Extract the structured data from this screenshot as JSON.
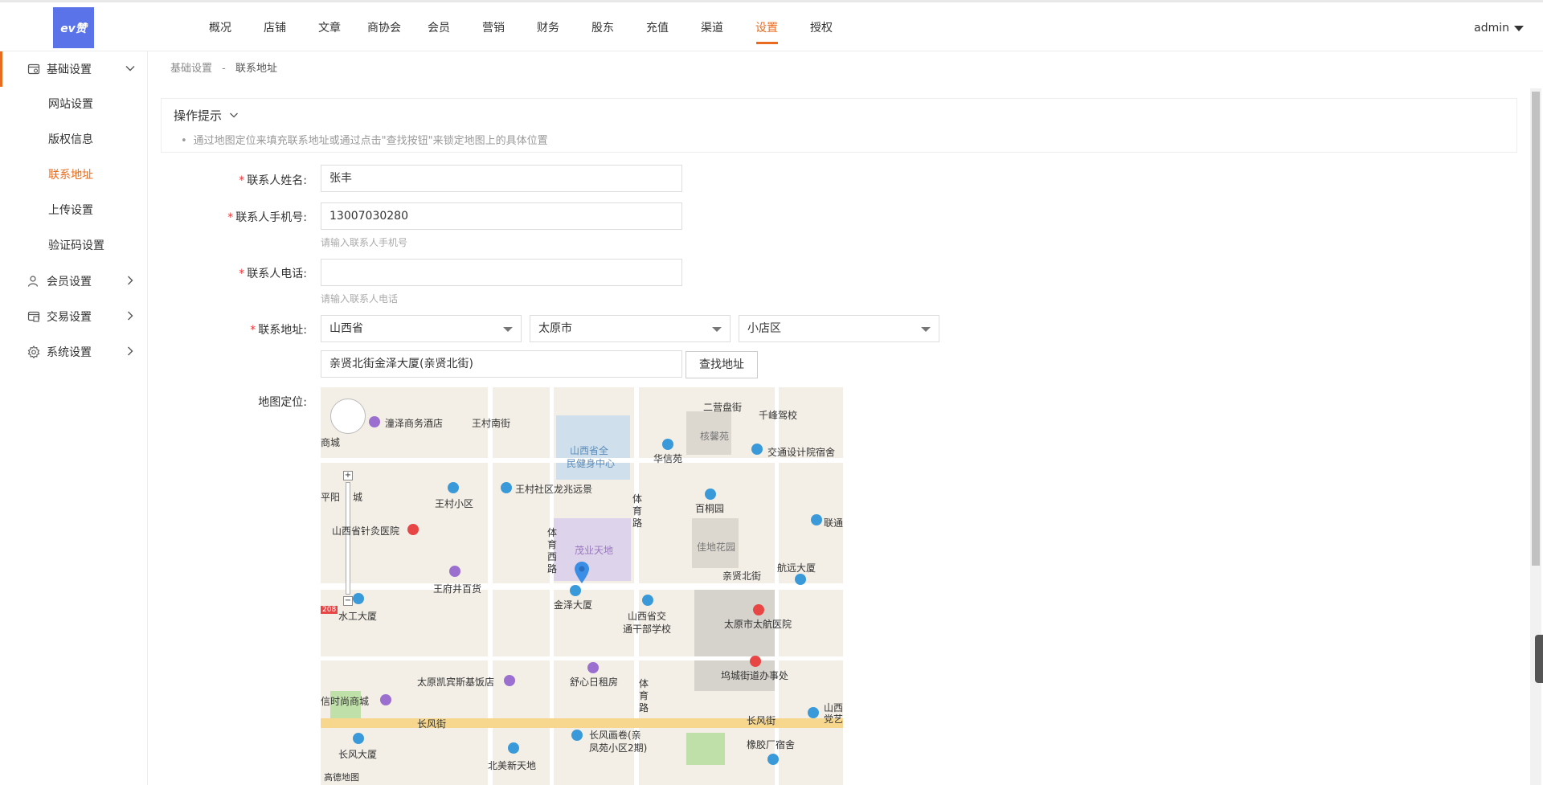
{
  "header": {
    "logo_text": "ev赞",
    "nav": [
      "概况",
      "店铺",
      "文章",
      "商协会",
      "会员",
      "营销",
      "财务",
      "股东",
      "充值",
      "渠道",
      "设置",
      "授权"
    ],
    "active_nav": "设置",
    "user": "admin"
  },
  "sidebar": {
    "groups": [
      {
        "label": "基础设置",
        "icon": "settings-card-icon",
        "open": true,
        "items": [
          "网站设置",
          "版权信息",
          "联系地址",
          "上传设置",
          "验证码设置"
        ]
      },
      {
        "label": "会员设置",
        "icon": "user-icon",
        "open": false
      },
      {
        "label": "交易设置",
        "icon": "trade-icon",
        "open": false
      },
      {
        "label": "系统设置",
        "icon": "gear-icon",
        "open": false
      }
    ],
    "active_item": "联系地址"
  },
  "breadcrumb": {
    "parent": "基础设置",
    "separator": "-",
    "current": "联系地址"
  },
  "tips": {
    "title": "操作提示",
    "text": "通过地图定位来填充联系地址或通过点击\"查找按钮\"来锁定地图上的具体位置"
  },
  "form": {
    "name_label": "联系人姓名:",
    "name_value": "张丰",
    "mobile_label": "联系人手机号:",
    "mobile_value": "13007030280",
    "mobile_hint": "请输入联系人手机号",
    "phone_label": "联系人电话:",
    "phone_value": "",
    "phone_hint": "请输入联系人电话",
    "address_label": "联系地址:",
    "province": "山西省",
    "city": "太原市",
    "district": "小店区",
    "street_value": "亲贤北街金泽大厦(亲贤北街)",
    "find_button": "查找地址",
    "map_label": "地图定位:"
  },
  "map": {
    "labels": [
      "潼泽商务酒店",
      "王村南街",
      "山西省全",
      "民健身中心",
      "二营盘街",
      "千峰驾校",
      "核馨苑",
      "华信苑",
      "交通设计院宿舍",
      "王村小区",
      "王村社区龙兆远景",
      "体",
      "育",
      "路",
      "百桐园",
      "联通",
      "平阳",
      "城",
      "山西省针灸医院",
      "体",
      "育",
      "西",
      "路",
      "茂业天地",
      "佳地花园",
      "亲贤北街",
      "航远大厦",
      "王府井百货",
      "金泽大厦",
      "山西省交",
      "通干部学校",
      "水工大厦",
      "太原市太航医院",
      "坞城街道办事处",
      "太原凯宾斯基饭店",
      "舒心日租房",
      "体",
      "育",
      "路",
      "信时尚商城",
      "长风街",
      "长风街",
      "山西",
      "党艺",
      "长风大厦",
      "长风画卷(亲",
      "凤苑小区2期)",
      "北美新天地",
      "橡胶厂宿舍",
      "商城",
      "208"
    ],
    "footer": "高德地图"
  }
}
